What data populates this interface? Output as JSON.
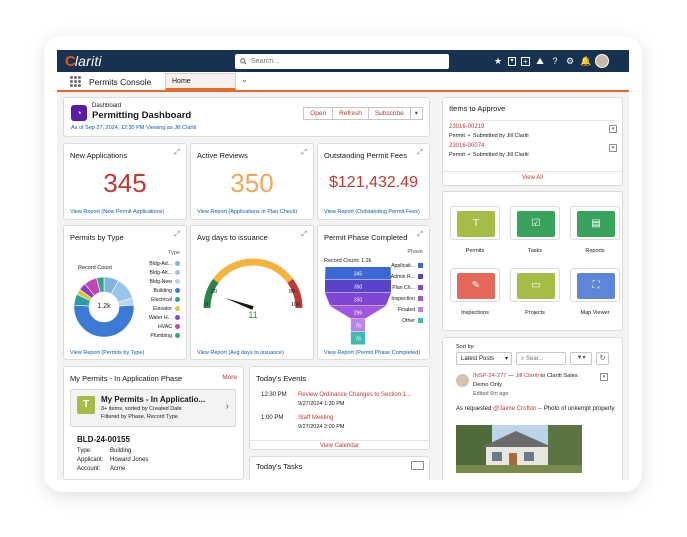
{
  "topbar": {
    "logo": "lariti",
    "logo_mark": "C",
    "search_placeholder": "Search...",
    "icons": [
      "star-icon",
      "add-icon",
      "trailhead-icon",
      "help-icon",
      "settings-icon",
      "bell-icon"
    ]
  },
  "appbar": {
    "app_name": "Permits Console",
    "tab_label": "Home"
  },
  "dashboard": {
    "subtitle": "Dashboard",
    "title": "Permitting Dashboard",
    "as_of": "As of Sep 27, 2024, 12:30 PM·Viewing as Jill Clariti",
    "buttons": [
      "Open",
      "Refresh",
      "Subscribe"
    ]
  },
  "metrics": {
    "new_applications": {
      "title": "New Applications",
      "value": "345",
      "link": "View Report (New Permit Applications)",
      "color": "#c23934"
    },
    "active_reviews": {
      "title": "Active Reviews",
      "value": "350",
      "link": "View Report (Applications in Plan Check)",
      "color": "#f5a65b"
    },
    "outstanding_fees": {
      "title": "Outstanding Permit Fees",
      "value": "$121,432.49",
      "link": "View Report (Outstanding Permit Fees)",
      "color": "#c23934"
    }
  },
  "permits_by_type": {
    "title": "Permits by Type",
    "record_count_label": "Record Count",
    "center_value": "1.2k",
    "legend_title": "Type",
    "link": "View Report (Permits by Type)"
  },
  "avg_days": {
    "title": "Avg days to issuance",
    "value": "11",
    "min": "0",
    "mid1": "20",
    "mid2": "80",
    "max": "100",
    "link": "View Report (Avg days to issuance)"
  },
  "phase": {
    "title": "Permit Phase Completed",
    "record_count": "Record Count: 1.2k",
    "legend_title": "Phase",
    "link": "View Report (Permit Phase Completed)"
  },
  "my_permits": {
    "title": "My Permits - In Application Phase",
    "more": "More",
    "list_title": "My Permits - In Applicatio...",
    "list_sub1": "3+ items, sorted by Created Date",
    "list_sub2": "Filtered by Phase, Record Type",
    "record_id": "BLD-24-00155",
    "fields": [
      {
        "label": "Type:",
        "value": "Building"
      },
      {
        "label": "Applicant:",
        "value": "Howard Jones"
      },
      {
        "label": "Account:",
        "value": "Acme"
      }
    ]
  },
  "events": {
    "title": "Today's Events",
    "items": [
      {
        "time": "12:30 PM",
        "name": "Review Ordinance Changes to Section 1...",
        "date": "9/27/2024 1:30 PM"
      },
      {
        "time": "1:00 PM",
        "name": "Staff Meeting",
        "date": "9/27/2024 2:00 PM"
      }
    ],
    "link": "View Calendar",
    "next_title": "Today's Tasks"
  },
  "approve": {
    "title": "Items to Approve",
    "items": [
      {
        "id": "23016-00219",
        "meta": "Permit  •  Submitted by Jill Clariti"
      },
      {
        "id": "23016-00074",
        "meta": "Permit  •  Submitted by Jill Clariti"
      }
    ],
    "view_all": "View All"
  },
  "tiles": [
    {
      "label": "Permits",
      "icon": "permit-icon",
      "color": "#a5bd45"
    },
    {
      "label": "Tasks",
      "icon": "tasks-icon",
      "color": "#3aa35b"
    },
    {
      "label": "Reports",
      "icon": "reports-icon",
      "color": "#3aa35b"
    },
    {
      "label": "Inspections",
      "icon": "inspection-icon",
      "color": "#e5675a"
    },
    {
      "label": "Projects",
      "icon": "projects-icon",
      "color": "#a5bd45"
    },
    {
      "label": "Map Viewer",
      "icon": "map-icon",
      "color": "#5e86d8"
    }
  ],
  "feed": {
    "sort_label": "Sort by:",
    "sort_value": "Latest Posts",
    "search_placeholder": "Sear...",
    "post_ref": "INSP-24-277",
    "post_arrow": "—",
    "post_author": "Jill Clariti",
    "post_to": "to Clariti Sales",
    "post_sub": "Demo Only",
    "post_time": "Edited 6m ago",
    "post_text_1": "As requested",
    "post_mention": "@Jaime Crofton",
    "post_text_2": "-- Photo of unkempt property"
  },
  "chart_data": [
    {
      "type": "pie",
      "title": "Permits by Type",
      "categories": [
        "Bldg-Ad...",
        "Bldg-Alt...",
        "Bldg-New",
        "Building",
        "Electrical",
        "Elevator",
        "Water H...",
        "HVAC",
        "Plumbing"
      ],
      "values": [
        8,
        12,
        4,
        52,
        6,
        3,
        4,
        7,
        4
      ],
      "colors": [
        "#7fb3e0",
        "#9bc4eb",
        "#b8d4f0",
        "#3b7bd6",
        "#2a9ea6",
        "#e1c52f",
        "#8b3fc9",
        "#c344b7",
        "#2fa87b"
      ]
    },
    {
      "type": "gauge",
      "title": "Avg days to issuance",
      "value": 11,
      "range": [
        0,
        100
      ]
    },
    {
      "type": "bar",
      "title": "Permit Phase Completed",
      "categories": [
        "Applicati...",
        "Admin R...",
        "Plan Ch...",
        "Inspection",
        "Finaled",
        "Other"
      ],
      "values": [
        345,
        350,
        350,
        296,
        76,
        76
      ],
      "colors": [
        "#3b66d6",
        "#5a43c9",
        "#8045d4",
        "#9f57e0",
        "#b985ea",
        "#3dbcb4"
      ]
    }
  ]
}
